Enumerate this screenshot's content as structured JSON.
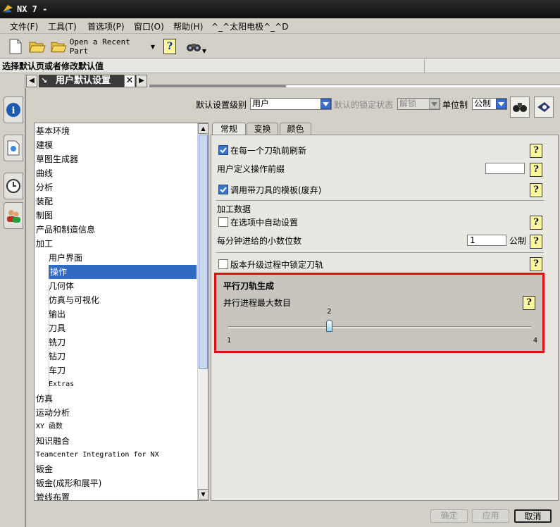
{
  "app": {
    "title": "NX 7 -"
  },
  "menu": [
    "文件(F)",
    "工具(T)",
    "首选项(P)",
    "窗口(O)",
    "帮助(H)",
    "^_^太阳电极^_^D"
  ],
  "toolbar": {
    "recent_label": "Open a Recent Part"
  },
  "status": {
    "text": "选择默认页或者修改默认值"
  },
  "dialog_tab": {
    "title": "用户默认设置"
  },
  "top": {
    "level_label": "默认设置级别",
    "level_value": "用户",
    "lock_label": "默认的锁定状态",
    "lock_value": "解锁",
    "unit_label": "单位制",
    "unit_value": "公制"
  },
  "tree": {
    "items": [
      {
        "label": "基本环境",
        "sub": false,
        "sel": false
      },
      {
        "label": "建模",
        "sub": false,
        "sel": false
      },
      {
        "label": "草图生成器",
        "sub": false,
        "sel": false
      },
      {
        "label": "曲线",
        "sub": false,
        "sel": false
      },
      {
        "label": "分析",
        "sub": false,
        "sel": false
      },
      {
        "label": "装配",
        "sub": false,
        "sel": false
      },
      {
        "label": "制图",
        "sub": false,
        "sel": false
      },
      {
        "label": "产品和制造信息",
        "sub": false,
        "sel": false
      },
      {
        "label": "加工",
        "sub": false,
        "sel": false
      },
      {
        "label": "用户界面",
        "sub": true,
        "sel": false
      },
      {
        "label": "操作",
        "sub": true,
        "sel": true
      },
      {
        "label": "几何体",
        "sub": true,
        "sel": false
      },
      {
        "label": "仿真与可视化",
        "sub": true,
        "sel": false
      },
      {
        "label": "输出",
        "sub": true,
        "sel": false
      },
      {
        "label": "刀具",
        "sub": true,
        "sel": false
      },
      {
        "label": "铣刀",
        "sub": true,
        "sel": false
      },
      {
        "label": "钻刀",
        "sub": true,
        "sel": false
      },
      {
        "label": "车刀",
        "sub": true,
        "sel": false
      },
      {
        "label": "Extras",
        "sub": true,
        "sel": false
      },
      {
        "label": "仿真",
        "sub": false,
        "sel": false
      },
      {
        "label": "运动分析",
        "sub": false,
        "sel": false
      },
      {
        "label": "XY 函数",
        "sub": false,
        "sel": false
      },
      {
        "label": "知识融合",
        "sub": false,
        "sel": false
      },
      {
        "label": "Teamcenter Integration for NX",
        "sub": false,
        "sel": false
      },
      {
        "label": "钣金",
        "sub": false,
        "sel": false
      },
      {
        "label": "钣金(成形和展平)",
        "sub": false,
        "sel": false
      },
      {
        "label": "管线布置",
        "sub": false,
        "sel": false
      }
    ]
  },
  "tabs": [
    "常规",
    "变换",
    "颜色"
  ],
  "options": {
    "refresh_label": "在每一个刀轨前刷新",
    "refresh_checked": true,
    "prefix_label": "用户定义操作前缀",
    "prefix_value": "",
    "template_label": "调用带刀具的模板(废弃)",
    "template_checked": true,
    "machining_data_label": "加工数据",
    "auto_set_label": "在选项中自动设置",
    "auto_set_checked": false,
    "decimals_label": "每分钟进给的小数位数",
    "decimals_value": "1",
    "decimals_unit": "公制",
    "lock_toolpath_label": "版本升级过程中锁定刀轨",
    "lock_toolpath_checked": false
  },
  "parallel": {
    "title": "平行刀轨生成",
    "max_label": "并行进程最大数目",
    "min": "1",
    "max": "4",
    "value": "2",
    "fraction": 0.3333
  },
  "buttons": {
    "ok": "确定",
    "apply": "应用",
    "cancel": "取消"
  },
  "help_glyph": "?"
}
